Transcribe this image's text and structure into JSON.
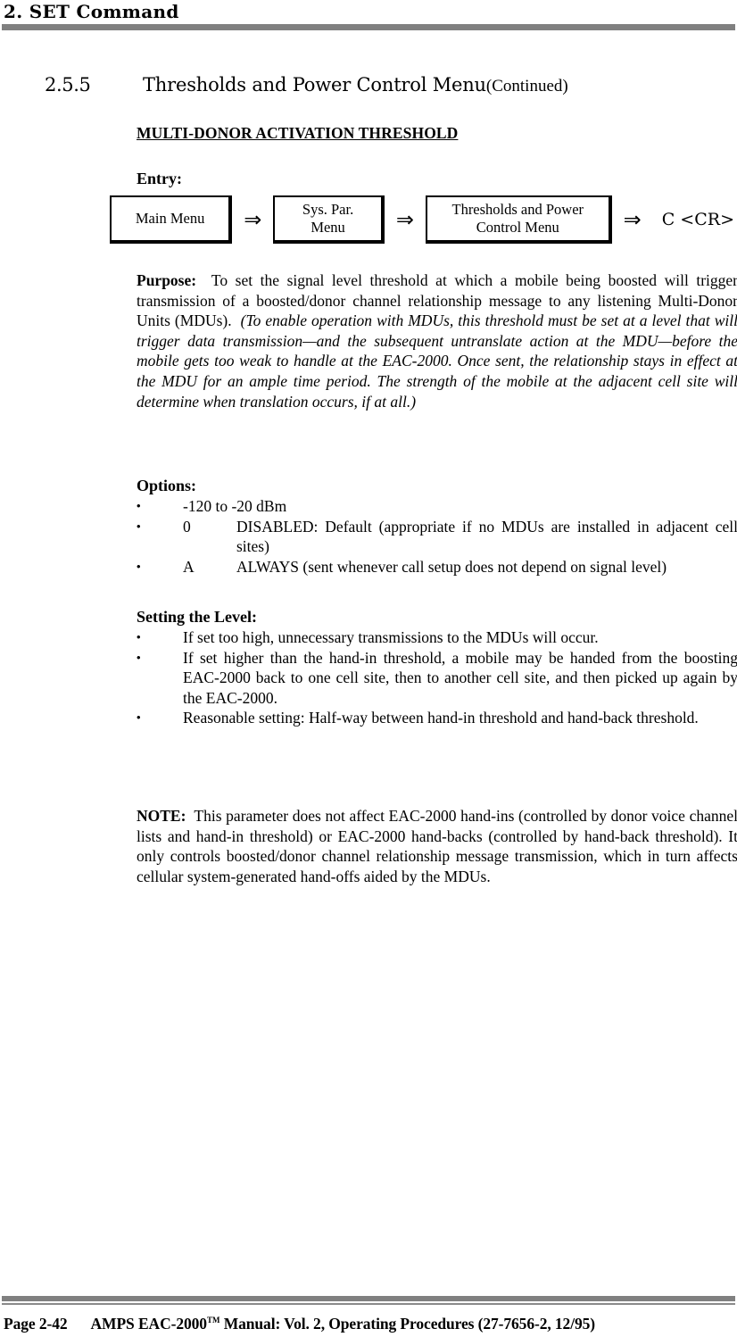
{
  "header": {
    "chapter_title": "2.  SET Command"
  },
  "section": {
    "number": "2.5.5",
    "title": "Thresholds and Power Control Menu",
    "continued": "(Continued)"
  },
  "parameter": {
    "name": "MULTI-DONOR ACTIVATION THRESHOLD"
  },
  "entry": {
    "label": "Entry:",
    "steps": [
      {
        "label": "Main Menu",
        "type": "box"
      },
      {
        "label": "⇒",
        "type": "arrow"
      },
      {
        "label": "Sys. Par. Menu",
        "line1": "Sys. Par.",
        "line2": "Menu",
        "type": "box"
      },
      {
        "label": "⇒",
        "type": "arrow"
      },
      {
        "label": "Thresholds and Power Control Menu",
        "line1": "Thresholds and Power",
        "line2": "Control Menu",
        "type": "box"
      },
      {
        "label": "⇒",
        "type": "arrow"
      },
      {
        "label": "C <CR>",
        "type": "command"
      }
    ]
  },
  "purpose": {
    "label": "Purpose:",
    "text_roman": "To set the signal level threshold at which a mobile being boosted will trigger transmission of a boosted/donor channel relationship message to any listening Multi-Donor Units (MDUs).",
    "text_italic": "(To enable operation with MDUs, this threshold must be set at a level that will trigger data transmission—and the subsequent untranslate action at the MDU—before the mobile gets too weak to handle at the EAC-2000.  Once sent, the relationship stays in effect at the MDU for an ample time period.  The strength of the mobile at the adjacent cell site will determine when translation occurs, if at all.)"
  },
  "options": {
    "label": "Options:",
    "bullet_glyph": "•",
    "items": [
      {
        "key": "",
        "text": "-120 to -20 dBm"
      },
      {
        "key": "0",
        "text": "DISABLED:  Default (appropriate if no MDUs are installed in adjacent cell sites)"
      },
      {
        "key": "A",
        "text": "ALWAYS (sent whenever call setup does not depend on signal level)"
      }
    ]
  },
  "setting_level": {
    "label": "Setting the Level:",
    "bullet_glyph": "•",
    "items": [
      "If set too high, unnecessary transmissions to the MDUs will occur.",
      "If set higher than the hand-in threshold, a mobile may be handed from the boosting EAC-2000 back to one cell site, then to another cell site, and then picked up again by the EAC-2000.",
      "Reasonable setting:  Half-way between hand-in threshold and hand-back threshold."
    ]
  },
  "note": {
    "label": "NOTE:",
    "text": "This parameter does not affect EAC-2000 hand-ins (controlled by donor voice channel lists and hand-in threshold) or EAC-2000 hand-backs (controlled by hand-back threshold).  It only controls boosted/donor channel relationship message transmission, which in turn affects cellular system-generated hand-offs aided by the MDUs."
  },
  "footer": {
    "page": "Page 2-42",
    "manual_part1": "AMPS EAC-2000",
    "manual_tm": "TM",
    "manual_part2": " Manual:  Vol. 2, Operating Procedures (27-7656-2, 12/95)"
  },
  "colors": {
    "rule_gray": "#808080",
    "text": "#000000",
    "page_background": "#ffffff"
  }
}
